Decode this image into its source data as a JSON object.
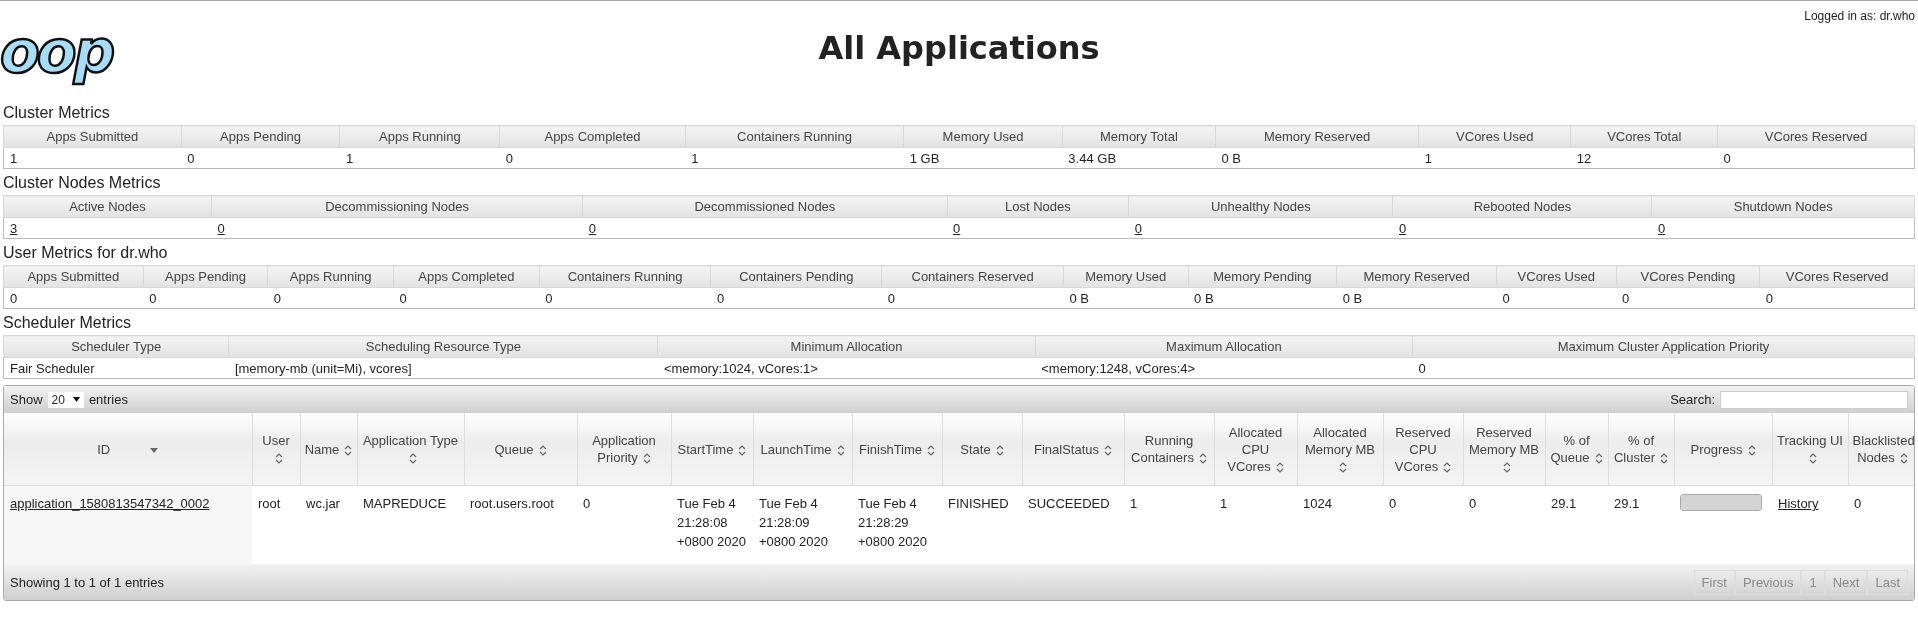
{
  "header": {
    "logo_text": "oop",
    "title": "All Applications",
    "login": "Logged in as: dr.who"
  },
  "sections": [
    {
      "title": "Cluster Metrics",
      "columns": [
        "Apps Submitted",
        "Apps Pending",
        "Apps Running",
        "Apps Completed",
        "Containers Running",
        "Memory Used",
        "Memory Total",
        "Memory Reserved",
        "VCores Used",
        "VCores Total",
        "VCores Reserved"
      ],
      "values": [
        {
          "text": "1",
          "link": false
        },
        {
          "text": "0",
          "link": false
        },
        {
          "text": "1",
          "link": false
        },
        {
          "text": "0",
          "link": false
        },
        {
          "text": "1",
          "link": false
        },
        {
          "text": "1 GB",
          "link": false
        },
        {
          "text": "3.44 GB",
          "link": false
        },
        {
          "text": "0 B",
          "link": false
        },
        {
          "text": "1",
          "link": false
        },
        {
          "text": "12",
          "link": false
        },
        {
          "text": "0",
          "link": false
        }
      ]
    },
    {
      "title": "Cluster Nodes Metrics",
      "columns": [
        "Active Nodes",
        "Decommissioning Nodes",
        "Decommissioned Nodes",
        "Lost Nodes",
        "Unhealthy Nodes",
        "Rebooted Nodes",
        "Shutdown Nodes"
      ],
      "values": [
        {
          "text": "3",
          "link": true
        },
        {
          "text": "0",
          "link": true
        },
        {
          "text": "0",
          "link": true
        },
        {
          "text": "0",
          "link": true
        },
        {
          "text": "0",
          "link": true
        },
        {
          "text": "0",
          "link": true
        },
        {
          "text": "0",
          "link": true
        }
      ]
    },
    {
      "title": "User Metrics for dr.who",
      "columns": [
        "Apps Submitted",
        "Apps Pending",
        "Apps Running",
        "Apps Completed",
        "Containers Running",
        "Containers Pending",
        "Containers Reserved",
        "Memory Used",
        "Memory Pending",
        "Memory Reserved",
        "VCores Used",
        "VCores Pending",
        "VCores Reserved"
      ],
      "values": [
        {
          "text": "0",
          "link": false
        },
        {
          "text": "0",
          "link": false
        },
        {
          "text": "0",
          "link": false
        },
        {
          "text": "0",
          "link": false
        },
        {
          "text": "0",
          "link": false
        },
        {
          "text": "0",
          "link": false
        },
        {
          "text": "0",
          "link": false
        },
        {
          "text": "0 B",
          "link": false
        },
        {
          "text": "0 B",
          "link": false
        },
        {
          "text": "0 B",
          "link": false
        },
        {
          "text": "0",
          "link": false
        },
        {
          "text": "0",
          "link": false
        },
        {
          "text": "0",
          "link": false
        }
      ]
    },
    {
      "title": "Scheduler Metrics",
      "columns": [
        "Scheduler Type",
        "Scheduling Resource Type",
        "Minimum Allocation",
        "Maximum Allocation",
        "Maximum Cluster Application Priority"
      ],
      "values": [
        {
          "text": "Fair Scheduler",
          "link": false
        },
        {
          "text": "[memory-mb (unit=Mi), vcores]",
          "link": false
        },
        {
          "text": "<memory:1024, vCores:1>",
          "link": false
        },
        {
          "text": "<memory:1248, vCores:4>",
          "link": false
        },
        {
          "text": "0",
          "link": false
        }
      ]
    }
  ],
  "apps": {
    "show_label": "Show",
    "show_value": "20",
    "entries_label": "entries",
    "search_label": "Search:",
    "columns": [
      {
        "label": "ID",
        "kind": "desc"
      },
      {
        "label": "User",
        "kind": "both"
      },
      {
        "label": "Name",
        "kind": "both"
      },
      {
        "label": "Application Type",
        "kind": "both"
      },
      {
        "label": "Queue",
        "kind": "both"
      },
      {
        "label": "Application Priority",
        "kind": "both"
      },
      {
        "label": "StartTime",
        "kind": "both"
      },
      {
        "label": "LaunchTime",
        "kind": "both"
      },
      {
        "label": "FinishTime",
        "kind": "both"
      },
      {
        "label": "State",
        "kind": "both"
      },
      {
        "label": "FinalStatus",
        "kind": "both"
      },
      {
        "label": "Running Containers",
        "kind": "both"
      },
      {
        "label": "Allocated CPU VCores",
        "kind": "both"
      },
      {
        "label": "Allocated Memory MB",
        "kind": "both"
      },
      {
        "label": "Reserved CPU VCores",
        "kind": "both"
      },
      {
        "label": "Reserved Memory MB",
        "kind": "both"
      },
      {
        "label": "% of Queue",
        "kind": "both"
      },
      {
        "label": "% of Cluster",
        "kind": "both"
      },
      {
        "label": "Progress",
        "kind": "both"
      },
      {
        "label": "Tracking UI",
        "kind": "both"
      },
      {
        "label": "Blacklisted Nodes",
        "kind": "both"
      }
    ],
    "rows": [
      {
        "cells": [
          {
            "kind": "link",
            "text": "application_1580813547342_0002"
          },
          {
            "kind": "text",
            "text": "root"
          },
          {
            "kind": "text",
            "text": "wc.jar"
          },
          {
            "kind": "text",
            "text": "MAPREDUCE"
          },
          {
            "kind": "text",
            "text": "root.users.root"
          },
          {
            "kind": "text",
            "text": "0"
          },
          {
            "kind": "text",
            "text": "Tue Feb 4 21:28:08 +0800 2020"
          },
          {
            "kind": "text",
            "text": "Tue Feb 4 21:28:09 +0800 2020"
          },
          {
            "kind": "text",
            "text": "Tue Feb 4 21:28:29 +0800 2020"
          },
          {
            "kind": "text",
            "text": "FINISHED"
          },
          {
            "kind": "text",
            "text": "SUCCEEDED"
          },
          {
            "kind": "text",
            "text": "1"
          },
          {
            "kind": "text",
            "text": "1"
          },
          {
            "kind": "text",
            "text": "1024"
          },
          {
            "kind": "text",
            "text": "0"
          },
          {
            "kind": "text",
            "text": "0"
          },
          {
            "kind": "text",
            "text": "29.1"
          },
          {
            "kind": "text",
            "text": "29.1"
          },
          {
            "kind": "progress",
            "level": 1
          },
          {
            "kind": "link",
            "text": "History"
          },
          {
            "kind": "text",
            "text": "0"
          }
        ]
      }
    ],
    "info": "Showing 1 to 1 of 1 entries",
    "pager": [
      {
        "label": "First",
        "disabled": true
      },
      {
        "label": "Previous",
        "disabled": true
      },
      {
        "label": "1",
        "disabled": true
      },
      {
        "label": "Next",
        "disabled": true
      },
      {
        "label": "Last",
        "disabled": true
      }
    ]
  }
}
